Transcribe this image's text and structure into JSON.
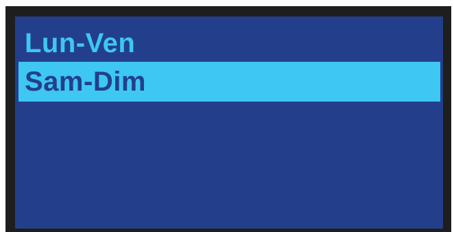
{
  "screen": {
    "colors": {
      "bezel": "#1e1e1e",
      "background": "#233f8b",
      "accent": "#3dc7f2"
    },
    "menu": {
      "selected_index": 1,
      "items": [
        {
          "label": "Lun-Ven"
        },
        {
          "label": "Sam-Dim"
        }
      ]
    }
  }
}
